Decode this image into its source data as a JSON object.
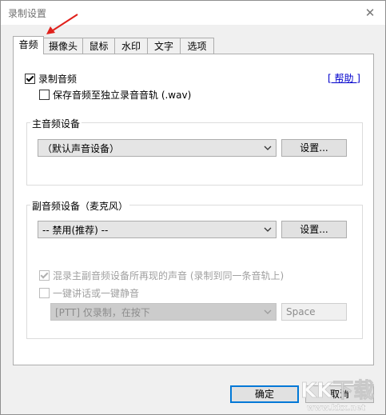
{
  "window": {
    "title": "录制设置",
    "close_symbol": "✕"
  },
  "tabs": [
    {
      "label": "音频",
      "active": true
    },
    {
      "label": "摄像头",
      "active": false
    },
    {
      "label": "鼠标",
      "active": false
    },
    {
      "label": "水印",
      "active": false
    },
    {
      "label": "文字",
      "active": false
    },
    {
      "label": "选项",
      "active": false
    }
  ],
  "audio": {
    "record_audio": {
      "label": "录制音频",
      "checked": true
    },
    "save_separate": {
      "label": "保存音频至独立录音音轨 (.wav)",
      "checked": false
    },
    "help_link": "[ 帮助 ]",
    "main_device": {
      "group_label": "主音频设备",
      "selected": "（默认声音设备）",
      "settings_button": "设置..."
    },
    "sub_device": {
      "group_label": "副音频设备（麦克风）",
      "selected": "-- 禁用(推荐) --",
      "settings_button": "设置...",
      "mix_option": {
        "label": "混录主副音频设备所再现的声音 (录制到同一条音轨上)",
        "checked": true,
        "enabled": false
      },
      "ptt_option": {
        "label": "一键讲话或一键静音",
        "checked": false,
        "enabled": false
      },
      "ptt_mode": "[PTT] 仅录制，在按下",
      "ptt_key": "Space"
    }
  },
  "footer": {
    "ok_label": "确定",
    "cancel_label": "取消"
  },
  "watermark": {
    "big": "KK下载",
    "url": "www.kkx.net"
  },
  "colors": {
    "link": "#0000cc",
    "accent_border": "#0078d7",
    "annotation_arrow": "#e0201b"
  }
}
